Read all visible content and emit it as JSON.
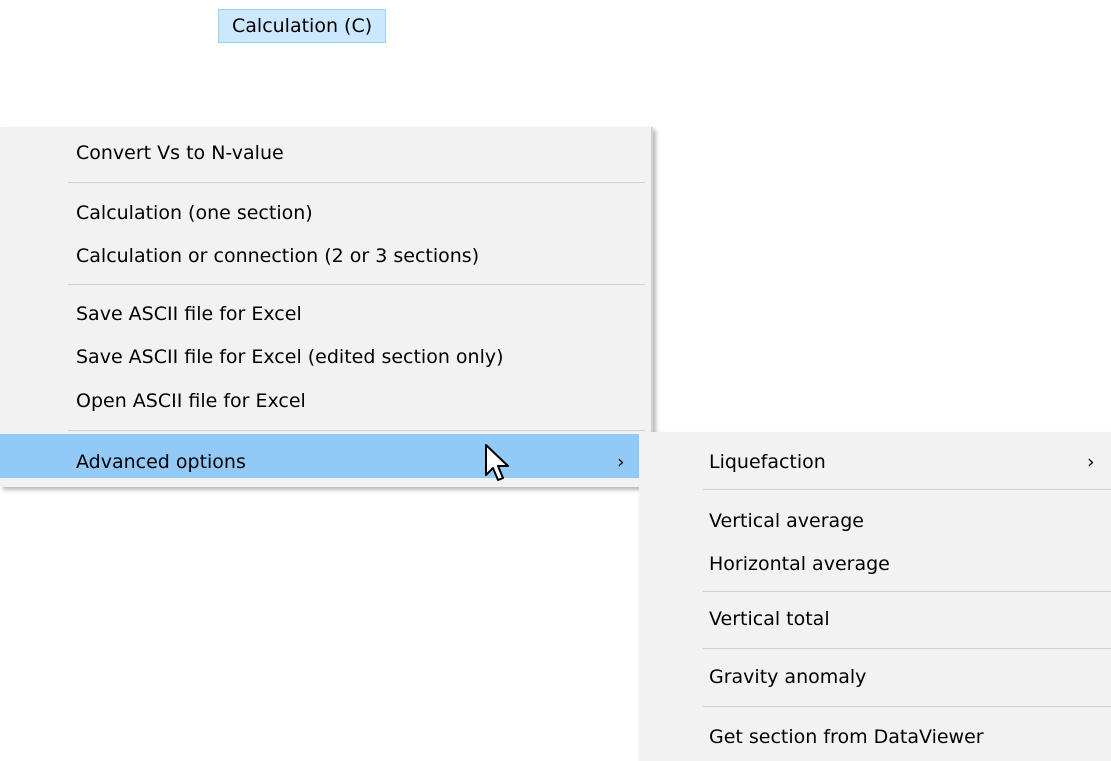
{
  "menubar": {
    "active_label": "Calculation (C)"
  },
  "main_menu": {
    "items": [
      {
        "label": "Convert Vs to N-value"
      },
      {
        "label": "Calculation (one section)"
      },
      {
        "label": "Calculation or connection (2 or 3 sections)"
      },
      {
        "label": "Save ASCII file for Excel"
      },
      {
        "label": "Save ASCII file for Excel (edited section only)"
      },
      {
        "label": "Open ASCII file for Excel"
      },
      {
        "label": "Advanced options",
        "arrow": "›"
      }
    ]
  },
  "submenu": {
    "items": [
      {
        "label": "Liquefaction",
        "arrow": "›"
      },
      {
        "label": "Vertical average"
      },
      {
        "label": "Horizontal average"
      },
      {
        "label": "Vertical total"
      },
      {
        "label": "Gravity anomaly"
      },
      {
        "label": "Get section from DataViewer"
      }
    ]
  },
  "colors": {
    "menu_bg": "#f2f2f2",
    "highlight": "#91c9f7",
    "menubar_active_bg": "#cce8ff"
  },
  "icons": {
    "cursor": "mouse-pointer-icon",
    "submenu_arrow": "chevron-right-icon"
  }
}
